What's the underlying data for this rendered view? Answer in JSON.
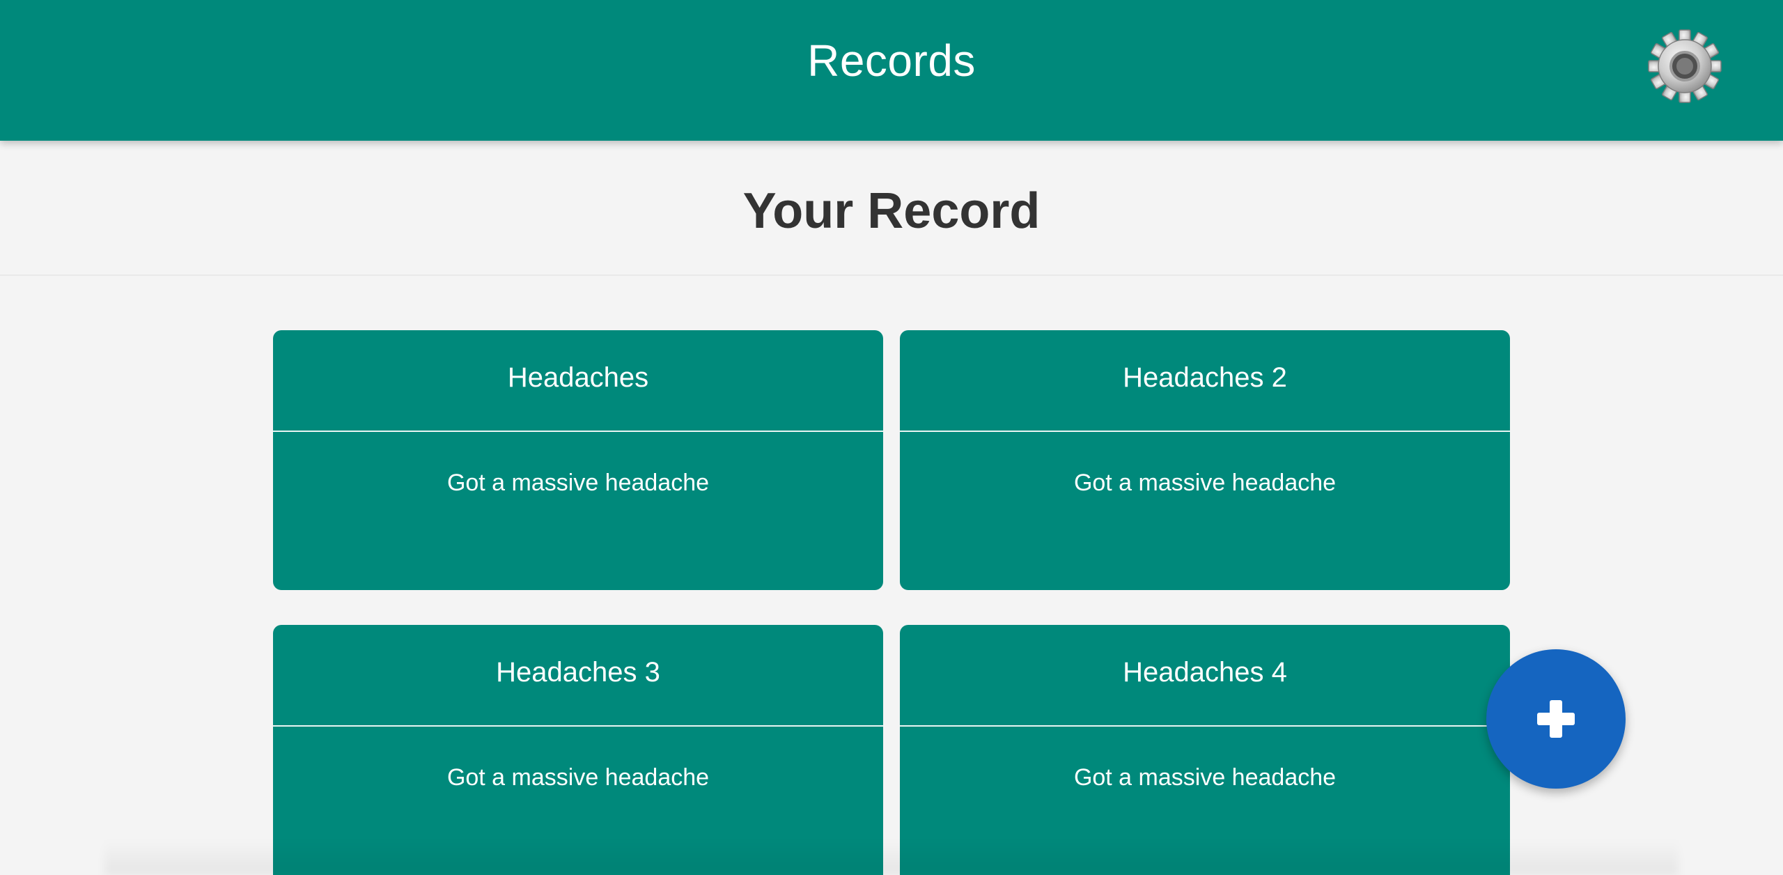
{
  "header": {
    "title": "Records",
    "settings_icon": "gear-icon",
    "background_color": "#00897b"
  },
  "subheader": {
    "title": "Your Record"
  },
  "records": [
    {
      "title": "Headaches",
      "description": "Got a massive headache"
    },
    {
      "title": "Headaches 2",
      "description": "Got a massive headache"
    },
    {
      "title": "Headaches 3",
      "description": "Got a massive headache"
    },
    {
      "title": "Headaches 4",
      "description": "Got a massive headache"
    }
  ],
  "fab": {
    "icon": "plus-icon",
    "color": "#1565c0"
  },
  "colors": {
    "card": "#00897b",
    "page_background": "#f4f4f4",
    "heading_text": "#333333"
  }
}
